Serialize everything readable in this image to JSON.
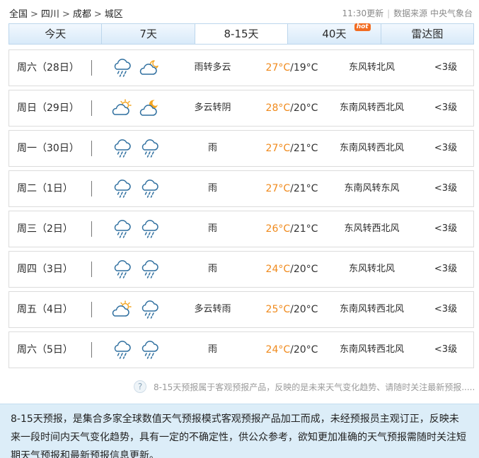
{
  "breadcrumb": {
    "items": [
      "全国",
      "四川",
      "成都",
      "城区"
    ],
    "separator": ">"
  },
  "source": {
    "update_time": "11:30更新",
    "label": "数据来源 中央气象台"
  },
  "tabs": [
    {
      "label": "今天",
      "active": false
    },
    {
      "label": "7天",
      "active": false
    },
    {
      "label": "8-15天",
      "active": true
    },
    {
      "label": "40天",
      "active": false,
      "badge": "hot"
    },
    {
      "label": "雷达图",
      "active": false
    }
  ],
  "forecast": [
    {
      "date": "周六（28日）",
      "icons": [
        "rain-icon",
        "partly-cloudy-night-icon"
      ],
      "weather": "雨转多云",
      "high": "27°C",
      "low": "/19°C",
      "wind": "东风转北风",
      "level": "<3级"
    },
    {
      "date": "周日（29日）",
      "icons": [
        "partly-cloudy-day-icon",
        "cloudy-night-icon"
      ],
      "weather": "多云转阴",
      "high": "28°C",
      "low": "/20°C",
      "wind": "东南风转西北风",
      "level": "<3级"
    },
    {
      "date": "周一（30日）",
      "icons": [
        "rain-icon",
        "rain-icon"
      ],
      "weather": "雨",
      "high": "27°C",
      "low": "/21°C",
      "wind": "东南风转西北风",
      "level": "<3级"
    },
    {
      "date": "周二（1日）",
      "icons": [
        "rain-icon",
        "rain-icon"
      ],
      "weather": "雨",
      "high": "27°C",
      "low": "/21°C",
      "wind": "东南风转东风",
      "level": "<3级"
    },
    {
      "date": "周三（2日）",
      "icons": [
        "rain-icon",
        "rain-icon"
      ],
      "weather": "雨",
      "high": "26°C",
      "low": "/21°C",
      "wind": "东风转西北风",
      "level": "<3级"
    },
    {
      "date": "周四（3日）",
      "icons": [
        "rain-icon",
        "rain-icon"
      ],
      "weather": "雨",
      "high": "24°C",
      "low": "/20°C",
      "wind": "东风转北风",
      "level": "<3级"
    },
    {
      "date": "周五（4日）",
      "icons": [
        "partly-cloudy-day-icon",
        "rain-icon"
      ],
      "weather": "多云转雨",
      "high": "25°C",
      "low": "/20°C",
      "wind": "东南风转西北风",
      "level": "<3级"
    },
    {
      "date": "周六（5日）",
      "icons": [
        "rain-icon",
        "rain-icon"
      ],
      "weather": "雨",
      "high": "24°C",
      "low": "/20°C",
      "wind": "东南风转西北风",
      "level": "<3级"
    }
  ],
  "note": {
    "icon": "?",
    "text": "8-15天预报属于客观预报产品，反映的是未来天气变化趋势、请随时关注最新预报......"
  },
  "info": "8-15天预报，是集合多家全球数值天气预报模式客观预报产品加工而成，未经预报员主观订正，反映未来一段时间内天气变化趋势，具有一定的不确定性，供公众参考，欲知更加准确的天气预报需随时关注短期天气预报和最新预报信息更新。",
  "colors": {
    "high_temp": "#f08a1c",
    "icon_stroke": "#2f6f9f",
    "sun": "#f4a623",
    "info_bg": "#dcedf8",
    "tab_border": "#bcd6ec"
  }
}
